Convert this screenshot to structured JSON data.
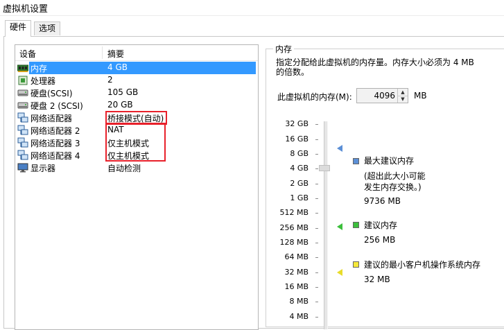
{
  "window": {
    "title": "虚拟机设置"
  },
  "tabs": [
    {
      "label": "硬件",
      "active": true
    },
    {
      "label": "选项",
      "active": false
    }
  ],
  "device_list": {
    "columns": {
      "device": "设备",
      "summary": "摘要"
    },
    "rows": [
      {
        "name": "内存",
        "summary": "4 GB",
        "icon": "memory-icon",
        "selected": true
      },
      {
        "name": "处理器",
        "summary": "2",
        "icon": "processor-icon"
      },
      {
        "name": "硬盘(SCSI)",
        "summary": "105 GB",
        "icon": "hard-disk-icon"
      },
      {
        "name": "硬盘 2 (SCSI)",
        "summary": "20 GB",
        "icon": "hard-disk-icon"
      },
      {
        "name": "网络适配器",
        "summary": "桥接模式(自动)",
        "icon": "network-adapter-icon"
      },
      {
        "name": "网络适配器 2",
        "summary": "NAT",
        "icon": "network-adapter-icon"
      },
      {
        "name": "网络适配器 3",
        "summary": "仅主机模式",
        "icon": "network-adapter-icon"
      },
      {
        "name": "网络适配器 4",
        "summary": "仅主机模式",
        "icon": "network-adapter-icon"
      },
      {
        "name": "显示器",
        "summary": "自动检测",
        "icon": "display-icon"
      }
    ]
  },
  "memory_panel": {
    "title": "内存",
    "description": "指定分配给此虚拟机的内存量。内存大小必须为 4 MB 的倍数。",
    "memory_label": "此虚拟机的内存(M):",
    "memory_value": "4096",
    "memory_unit": "MB",
    "scale_labels": [
      "32 GB",
      "16 GB",
      "8 GB",
      "4 GB",
      "2 GB",
      "1 GB",
      "512 MB",
      "256 MB",
      "128 MB",
      "64 MB",
      "32 MB",
      "16 MB",
      "8 MB",
      "4 MB"
    ],
    "slider_value_mb": 4096,
    "legend": {
      "max_recommended": {
        "title": "最大建议内存",
        "note_line1": "(超出此大小可能",
        "note_line2": "发生内存交换。)",
        "value": "9736 MB",
        "color": "#5b8fd6"
      },
      "recommended": {
        "title": "建议内存",
        "value": "256 MB",
        "color": "#3cbf3c"
      },
      "guest_min": {
        "title": "建议的最小客户机操作系统内存",
        "value": "32 MB",
        "color": "#f5e83a"
      }
    }
  },
  "colors": {
    "selection": "#3399ff",
    "highlight_box": "#e8202a"
  }
}
